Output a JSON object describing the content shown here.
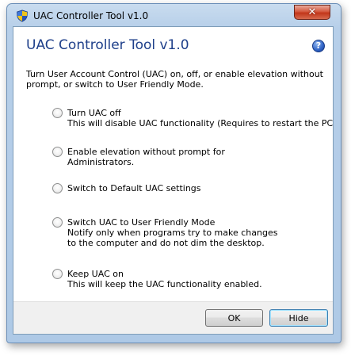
{
  "window": {
    "title": "UAC Controller Tool v1.0",
    "close_glyph": "✕"
  },
  "header": {
    "heading": "UAC Controller Tool v1.0",
    "help_glyph": "?",
    "intro": "Turn User Account Control (UAC) on, off, or enable elevation without prompt, or switch to User Friendly Mode."
  },
  "options": [
    {
      "label": "Turn UAC off",
      "description": "This will disable UAC functionality (Requires to restart the PC).",
      "selected": false
    },
    {
      "label": "Enable elevation without prompt for",
      "description": "Administrators.",
      "selected": false
    },
    {
      "label": "Switch to Default UAC settings",
      "description": "",
      "selected": false
    },
    {
      "label": "Switch UAC to User Friendly Mode",
      "description_lines": [
        "Notify only when programs try to make changes",
        "to the computer and do not dim the desktop."
      ],
      "selected": false
    },
    {
      "label": "Keep UAC on",
      "description": "This will keep the UAC functionality enabled.",
      "selected": false
    }
  ],
  "buttons": {
    "ok_label": "OK",
    "hide_label": "Hide"
  },
  "colors": {
    "heading": "#1e3f8a",
    "frame": "#b7cfe9",
    "close": "#c2361a"
  }
}
